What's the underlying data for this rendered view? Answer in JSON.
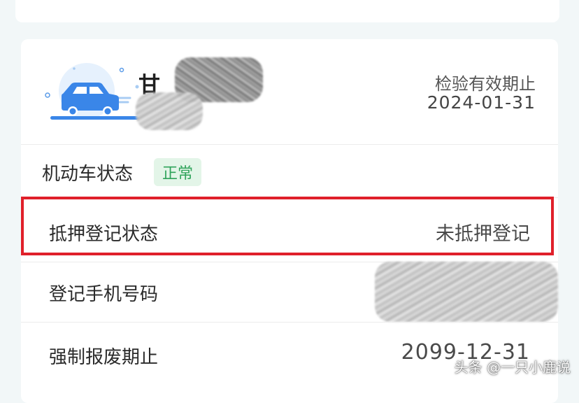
{
  "vehicle": {
    "plate_prefix": "甘",
    "inspection_label": "检验有效期止",
    "inspection_date": "2024-01-31"
  },
  "motor_status": {
    "label": "机动车状态",
    "badge": "正常"
  },
  "mortgage": {
    "label": "抵押登记状态",
    "value": "未抵押登记"
  },
  "phone": {
    "label": "登记手机号码"
  },
  "scrap": {
    "label": "强制报废期止",
    "value": "2099-12-31"
  },
  "watermark": {
    "text": "头条 @一只小鹿说"
  },
  "colors": {
    "accent_blue": "#3a86e8",
    "status_green": "#2fa35a",
    "highlight_red": "#e0202a"
  },
  "icons": [
    "car-icon"
  ]
}
